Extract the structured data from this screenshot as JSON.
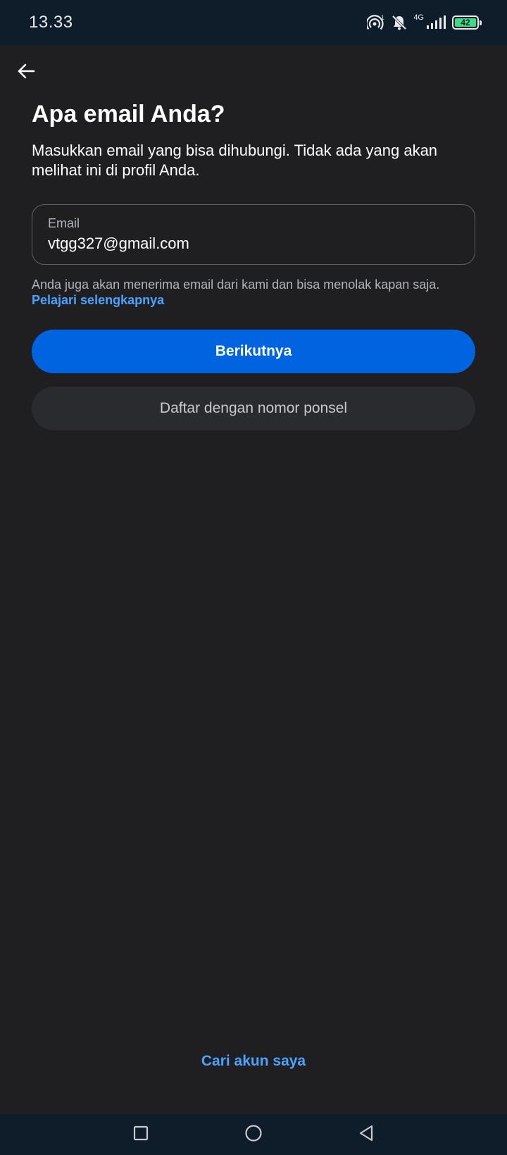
{
  "status_bar": {
    "time": "13.33",
    "network_label": "4G",
    "battery_level": "42",
    "icons": [
      "hotspot-icon",
      "bell-off-icon",
      "signal-icon",
      "battery-icon"
    ]
  },
  "header": {
    "back_icon": "arrow-left-icon"
  },
  "main": {
    "title": "Apa email Anda?",
    "subtitle": "Masukkan email yang bisa dihubungi. Tidak ada yang akan melihat ini di profil Anda.",
    "email_field": {
      "label": "Email",
      "value": "vtgg327@gmail.com"
    },
    "helper_text": "Anda juga akan menerima email dari kami dan bisa menolak kapan saja.",
    "learn_more_label": "Pelajari selengkapnya",
    "next_button_label": "Berikutnya",
    "phone_signup_label": "Daftar dengan nomor ponsel",
    "find_account_label": "Cari akun saya"
  },
  "nav_bar": {
    "icons": [
      "recents-square-icon",
      "home-circle-icon",
      "back-triangle-icon"
    ]
  },
  "colors": {
    "background": "#1f1f21",
    "primary": "#0064e0",
    "link": "#4aa3ff",
    "system_bar": "#0f1d2b"
  }
}
